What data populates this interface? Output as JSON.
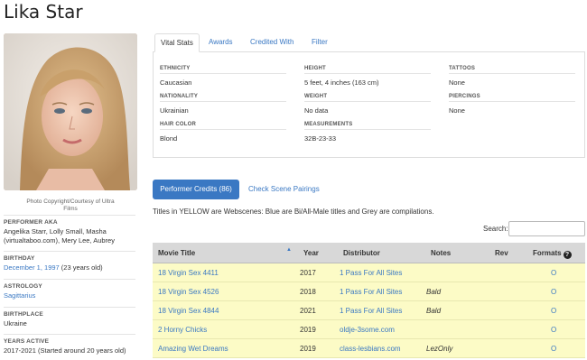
{
  "performer": {
    "name": "Lika Star",
    "photo_credit": "Photo Copyright/Courtesy of Ultra Films"
  },
  "left": {
    "aka_label": "PERFORMER AKA",
    "aka_value": "Angelika Starr, Lolly Small, Masha (virtualtaboo.com), Mery Lee, Aubrey",
    "birthday_label": "BIRTHDAY",
    "birthday_date": "December 1, 1997",
    "birthday_age": " (23 years old)",
    "astrology_label": "ASTROLOGY",
    "astrology_value": "Sagittarius",
    "birthplace_label": "BIRTHPLACE",
    "birthplace_value": "Ukraine",
    "years_label": "YEARS ACTIVE",
    "years_value": "2017-2021 (Started around 20 years old)"
  },
  "tabs": [
    "Vital Stats",
    "Awards",
    "Credited With",
    "Filter"
  ],
  "stats": {
    "ethnicity_label": "ETHNICITY",
    "ethnicity_value": "Caucasian",
    "nationality_label": "NATIONALITY",
    "nationality_value": "Ukrainian",
    "hair_label": "HAIR COLOR",
    "hair_value": "Blond",
    "height_label": "HEIGHT",
    "height_value": "5 feet, 4 inches (163 cm)",
    "weight_label": "WEIGHT",
    "weight_value": "No data",
    "measurements_label": "MEASUREMENTS",
    "measurements_value": "32B-23-33",
    "tattoos_label": "TATTOOS",
    "tattoos_value": "None",
    "piercings_label": "PIERCINGS",
    "piercings_value": "None"
  },
  "credits": {
    "button_label": "Performer Credits (86)",
    "pairings_link": "Check Scene Pairings",
    "note": "Titles in YELLOW are Webscenes: Blue are Bi/All-Male titles and Grey are compilations.",
    "search_label": "Search:",
    "search_value": ""
  },
  "table": {
    "headers": [
      "Movie Title",
      "Year",
      "Distributor",
      "Notes",
      "Rev",
      "Formats"
    ],
    "sort_indicator": "▲",
    "help_glyph": "?",
    "rows": [
      {
        "title": "18 Virgin Sex 4411",
        "year": "2017",
        "distributor": "1 Pass For All Sites",
        "notes": "",
        "rev": "",
        "format": "O"
      },
      {
        "title": "18 Virgin Sex 4526",
        "year": "2018",
        "distributor": "1 Pass For All Sites",
        "notes": "Bald",
        "rev": "",
        "format": "O"
      },
      {
        "title": "18 Virgin Sex 4844",
        "year": "2021",
        "distributor": "1 Pass For All Sites",
        "notes": "Bald",
        "rev": "",
        "format": "O"
      },
      {
        "title": "2 Horny Chicks",
        "year": "2019",
        "distributor": "oldje-3some.com",
        "notes": "",
        "rev": "",
        "format": "O"
      },
      {
        "title": "Amazing Wet Dreams",
        "year": "2019",
        "distributor": "class-lesbians.com",
        "notes": "LezOnly",
        "rev": "",
        "format": "O"
      }
    ]
  },
  "colors": {
    "link": "#3a78c3",
    "webscene_row": "#fcfbc6",
    "header_bg": "#d8d8d8"
  }
}
